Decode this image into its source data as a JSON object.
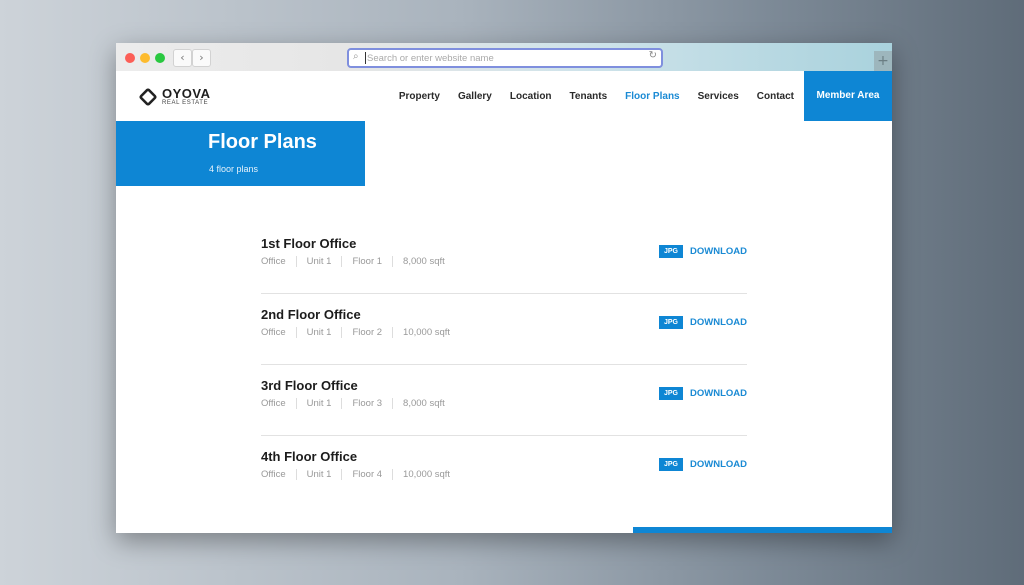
{
  "browser": {
    "url_placeholder": "Search or enter website name",
    "url_value": "",
    "back_icon": "‹",
    "forward_icon": "›",
    "search_icon": "⌕",
    "reload_icon": "↻",
    "new_tab_icon": "+"
  },
  "site": {
    "logo_name": "OYOVA",
    "logo_sub": "REAL ESTATE",
    "nav": [
      {
        "label": "Property"
      },
      {
        "label": "Gallery"
      },
      {
        "label": "Location"
      },
      {
        "label": "Tenants"
      },
      {
        "label": "Floor Plans",
        "active": true
      },
      {
        "label": "Services"
      },
      {
        "label": "Contact"
      }
    ],
    "member_label": "Member Area",
    "accent_color": "#0e86d4"
  },
  "hero": {
    "title": "Floor Plans",
    "subtitle": "4 floor plans"
  },
  "floor_plans": [
    {
      "title": "1st Floor Office",
      "type": "Office",
      "unit": "Unit 1",
      "floor": "Floor 1",
      "size": "8,000 sqft",
      "format": "JPG",
      "action": "DOWNLOAD"
    },
    {
      "title": "2nd Floor Office",
      "type": "Office",
      "unit": "Unit 1",
      "floor": "Floor 2",
      "size": "10,000 sqft",
      "format": "JPG",
      "action": "DOWNLOAD"
    },
    {
      "title": "3rd Floor Office",
      "type": "Office",
      "unit": "Unit 1",
      "floor": "Floor 3",
      "size": "8,000 sqft",
      "format": "JPG",
      "action": "DOWNLOAD"
    },
    {
      "title": "4th Floor Office",
      "type": "Office",
      "unit": "Unit 1",
      "floor": "Floor 4",
      "size": "10,000 sqft",
      "format": "JPG",
      "action": "DOWNLOAD"
    }
  ]
}
